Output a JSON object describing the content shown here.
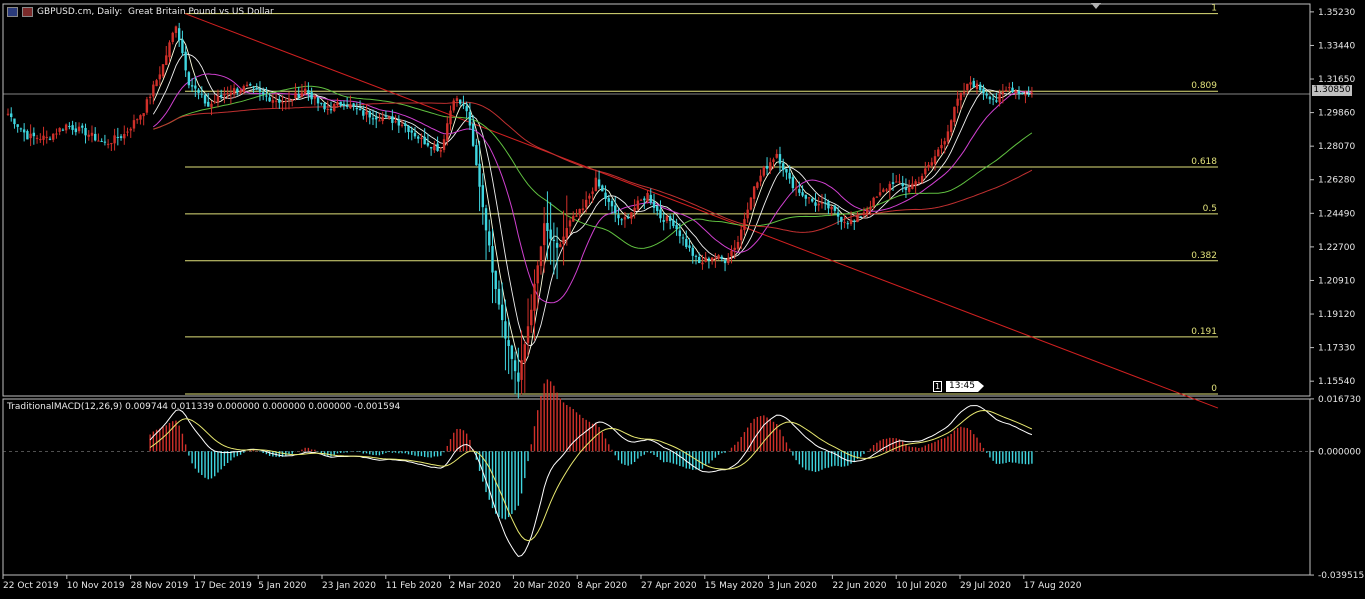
{
  "header": {
    "symbol": "GBPUSD.cm",
    "timeframe": "Daily",
    "description": "Great Britain Pound vs US Dollar",
    "full_text": "GBPUSD.cm, Daily:  Great Britain Pound vs US Dollar"
  },
  "current_price_label": "1.30850",
  "time_label": "13:45",
  "time_label_prefix": "1",
  "macd": {
    "label": "TraditionalMACD(12,26,9) 0.009744 0.011339 0.000000 0.000000 0.000000 -0.001594",
    "y_ticks": [
      "0.016730",
      "0.000000",
      "-0.039515"
    ]
  },
  "colors": {
    "background": "#000000",
    "bull": "#d0302a",
    "bear": "#3fd6e0",
    "fibo": "#e0e07a",
    "trendline": "#d02020",
    "macd_line": "#ffffff",
    "signal_line": "#e8e870",
    "ma_fast": "#ffffe0",
    "ma_magenta": "#d040d0",
    "ma_green": "#60c040",
    "ma_red": "#c03030",
    "grid": "#808080"
  },
  "chart_data": {
    "type": "candlestick",
    "title": "GBPUSD.cm, Daily",
    "y_ticks": [
      "1.35230",
      "1.33440",
      "1.31650",
      "1.29860",
      "1.28070",
      "1.26280",
      "1.24490",
      "1.22700",
      "1.20910",
      "1.19120",
      "1.17330",
      "1.15540"
    ],
    "x_ticks": [
      "22 Oct 2019",
      "10 Nov 2019",
      "28 Nov 2019",
      "17 Dec 2019",
      "5 Jan 2020",
      "23 Jan 2020",
      "11 Feb 2020",
      "2 Mar 2020",
      "20 Mar 2020",
      "8 Apr 2020",
      "27 Apr 2020",
      "15 May 2020",
      "3 Jun 2020",
      "22 Jun 2020",
      "10 Jul 2020",
      "29 Jul 2020",
      "17 Aug 2020"
    ],
    "ylim": [
      1.1475,
      1.3565
    ],
    "fibonacci": [
      {
        "label": "1",
        "price": 1.3514
      },
      {
        "label": "0.809",
        "price": 1.31
      },
      {
        "label": "0.618",
        "price": 1.2696
      },
      {
        "label": "0.5",
        "price": 1.2446
      },
      {
        "label": "0.382",
        "price": 1.2196
      },
      {
        "label": "0.191",
        "price": 1.179
      },
      {
        "label": "0",
        "price": 1.14
      }
    ],
    "close_path": [
      [
        0,
        1.298
      ],
      [
        6,
        1.286
      ],
      [
        12,
        1.285
      ],
      [
        18,
        1.292
      ],
      [
        24,
        1.288
      ],
      [
        30,
        1.282
      ],
      [
        36,
        1.287
      ],
      [
        42,
        1.3
      ],
      [
        48,
        1.324
      ],
      [
        52,
        1.346
      ],
      [
        56,
        1.315
      ],
      [
        62,
        1.302
      ],
      [
        68,
        1.31
      ],
      [
        74,
        1.312
      ],
      [
        80,
        1.307
      ],
      [
        86,
        1.304
      ],
      [
        92,
        1.311
      ],
      [
        98,
        1.3
      ],
      [
        104,
        1.304
      ],
      [
        110,
        1.298
      ],
      [
        116,
        1.296
      ],
      [
        122,
        1.293
      ],
      [
        128,
        1.284
      ],
      [
        134,
        1.279
      ],
      [
        138,
        1.307
      ],
      [
        142,
        1.3
      ],
      [
        146,
        1.26
      ],
      [
        150,
        1.215
      ],
      [
        154,
        1.18
      ],
      [
        158,
        1.155
      ],
      [
        162,
        1.195
      ],
      [
        166,
        1.238
      ],
      [
        170,
        1.225
      ],
      [
        174,
        1.24
      ],
      [
        178,
        1.247
      ],
      [
        182,
        1.262
      ],
      [
        186,
        1.25
      ],
      [
        190,
        1.24
      ],
      [
        194,
        1.248
      ],
      [
        198,
        1.255
      ],
      [
        202,
        1.243
      ],
      [
        206,
        1.24
      ],
      [
        210,
        1.228
      ],
      [
        214,
        1.218
      ],
      [
        218,
        1.222
      ],
      [
        222,
        1.22
      ],
      [
        226,
        1.23
      ],
      [
        230,
        1.255
      ],
      [
        234,
        1.268
      ],
      [
        238,
        1.277
      ],
      [
        242,
        1.262
      ],
      [
        246,
        1.255
      ],
      [
        250,
        1.25
      ],
      [
        254,
        1.248
      ],
      [
        258,
        1.242
      ],
      [
        262,
        1.24
      ],
      [
        266,
        1.248
      ],
      [
        270,
        1.255
      ],
      [
        274,
        1.262
      ],
      [
        278,
        1.258
      ],
      [
        282,
        1.263
      ],
      [
        286,
        1.272
      ],
      [
        290,
        1.285
      ],
      [
        294,
        1.305
      ],
      [
        298,
        1.315
      ],
      [
        302,
        1.31
      ],
      [
        306,
        1.305
      ],
      [
        310,
        1.312
      ],
      [
        314,
        1.309
      ]
    ],
    "macd_ylim": [
      -0.0395,
      0.0167
    ]
  }
}
